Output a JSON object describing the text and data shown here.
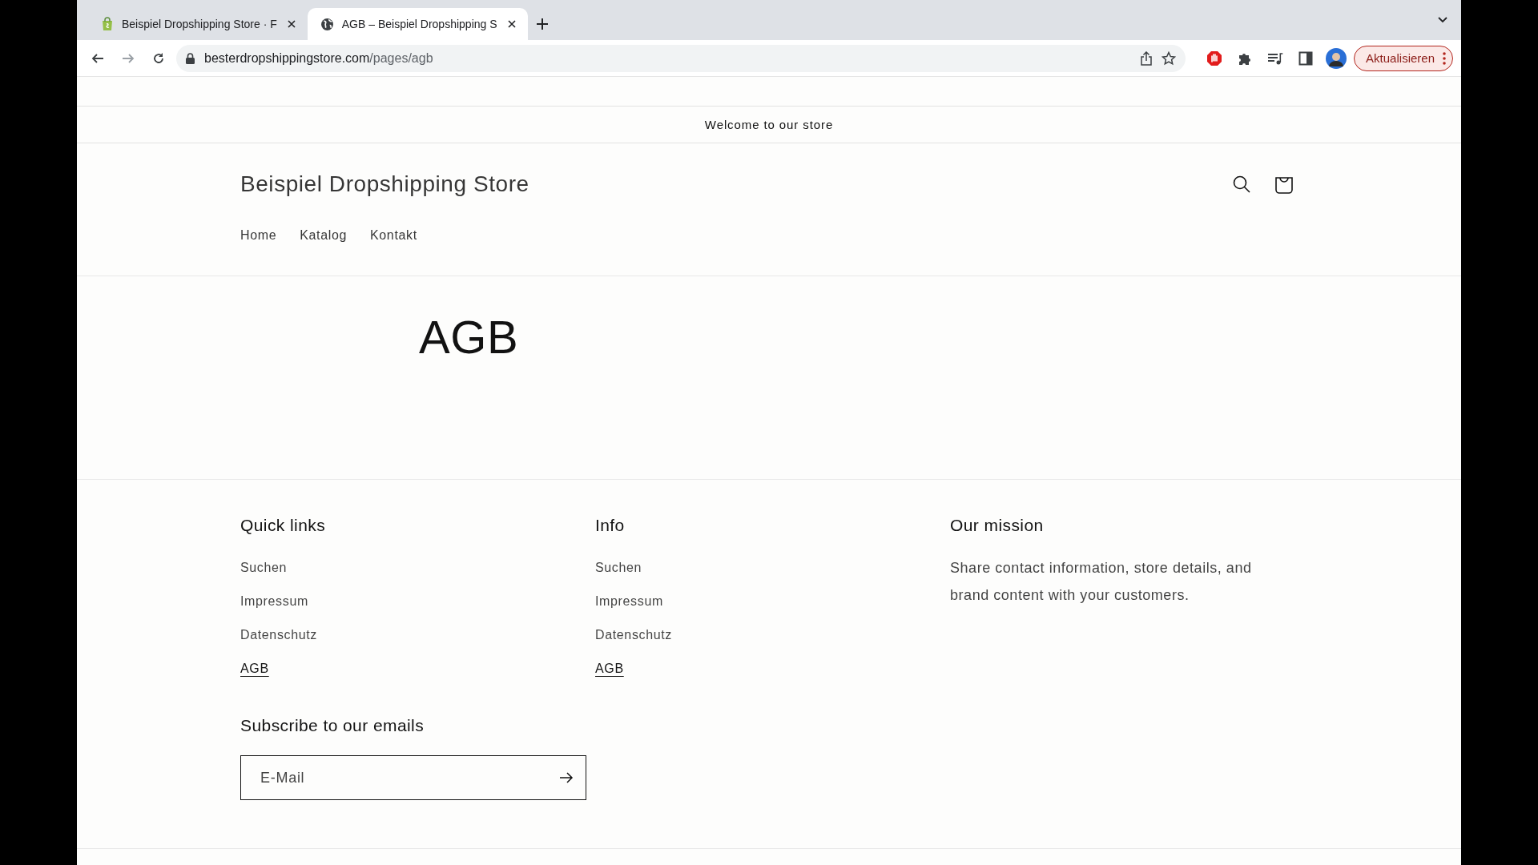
{
  "browser": {
    "tabs": [
      {
        "title": "Beispiel Dropshipping Store · F",
        "selected": false
      },
      {
        "title": "AGB – Beispiel Dropshipping S",
        "selected": true
      }
    ],
    "url_host": "besterdropshippingstore.com",
    "url_path": "/pages/agb",
    "update_button": "Aktualisieren"
  },
  "announcement": "Welcome to our store",
  "header": {
    "store_name": "Beispiel Dropshipping Store",
    "nav": [
      {
        "label": "Home"
      },
      {
        "label": "Katalog"
      },
      {
        "label": "Kontakt"
      }
    ]
  },
  "page": {
    "title": "AGB"
  },
  "footer": {
    "columns": [
      {
        "kind": "links",
        "heading": "Quick links",
        "links": [
          {
            "label": "Suchen",
            "selected": false
          },
          {
            "label": "Impressum",
            "selected": false
          },
          {
            "label": "Datenschutz",
            "selected": false
          },
          {
            "label": "AGB",
            "selected": true
          }
        ]
      },
      {
        "kind": "links",
        "heading": "Info",
        "links": [
          {
            "label": "Suchen",
            "selected": false
          },
          {
            "label": "Impressum",
            "selected": false
          },
          {
            "label": "Datenschutz",
            "selected": false
          },
          {
            "label": "AGB",
            "selected": true
          }
        ]
      },
      {
        "kind": "text",
        "heading": "Our mission",
        "text": "Share contact information, store details, and brand content with your customers."
      }
    ],
    "newsletter": {
      "heading": "Subscribe to our emails",
      "placeholder": "E-Mail"
    }
  }
}
